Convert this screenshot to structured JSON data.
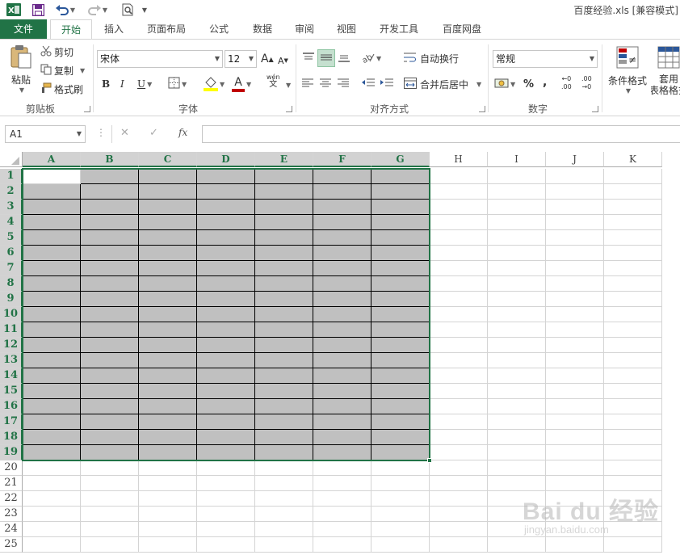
{
  "title_bar": {
    "title": "百度经验.xls  [兼容模式]",
    "app_icon": "excel-icon",
    "quick_access": [
      "save-icon",
      "undo-icon",
      "redo-icon",
      "print-preview-icon",
      "customize-icon"
    ]
  },
  "tabs": [
    {
      "id": "file",
      "label": "文件"
    },
    {
      "id": "home",
      "label": "开始"
    },
    {
      "id": "insert",
      "label": "插入"
    },
    {
      "id": "layout",
      "label": "页面布局"
    },
    {
      "id": "formulas",
      "label": "公式"
    },
    {
      "id": "data",
      "label": "数据"
    },
    {
      "id": "review",
      "label": "审阅"
    },
    {
      "id": "view",
      "label": "视图"
    },
    {
      "id": "developer",
      "label": "开发工具"
    },
    {
      "id": "baidu",
      "label": "百度网盘"
    }
  ],
  "ribbon": {
    "clipboard": {
      "group_label": "剪贴板",
      "paste": "粘贴",
      "cut": "剪切",
      "copy": "复制",
      "format_painter": "格式刷"
    },
    "font": {
      "group_label": "字体",
      "font_name": "宋体",
      "font_size": "12",
      "bold": "B",
      "italic": "I",
      "underline": "U",
      "grow": "A",
      "shrink": "A",
      "font_color": "A",
      "phonetic": "wén",
      "phonetic_sub": "文"
    },
    "alignment": {
      "group_label": "对齐方式",
      "wrap_text": "自动换行",
      "merge_center": "合并后居中"
    },
    "number": {
      "group_label": "数字",
      "format": "常规",
      "percent": "%",
      "comma": ",",
      "inc_decimal_a": "←0",
      "inc_decimal_b": ".00",
      "dec_decimal_a": ".00",
      "dec_decimal_b": "→0"
    },
    "styles": {
      "conditional_format": "条件格式",
      "table_format_line1": "套用",
      "table_format_line2": "表格格式"
    }
  },
  "formula_bar": {
    "name_box": "A1",
    "cancel": "✕",
    "enter": "✓",
    "fx": "fx",
    "content": ""
  },
  "sheet": {
    "columns": [
      "A",
      "B",
      "C",
      "D",
      "E",
      "F",
      "G",
      "H",
      "I",
      "J",
      "K"
    ],
    "rows": [
      "1",
      "2",
      "3",
      "4",
      "5",
      "6",
      "7",
      "8",
      "9",
      "10",
      "11",
      "12",
      "13",
      "14",
      "15",
      "16",
      "17",
      "18",
      "19",
      "20",
      "21",
      "22",
      "23",
      "24",
      "25"
    ],
    "selection": "A1:G19",
    "active_cell": "A1",
    "fill_color": "#C0C0C0",
    "accent_color": "#217346"
  },
  "watermark": {
    "main": "Bai du 经验",
    "sub": "jingyan.baidu.com"
  }
}
